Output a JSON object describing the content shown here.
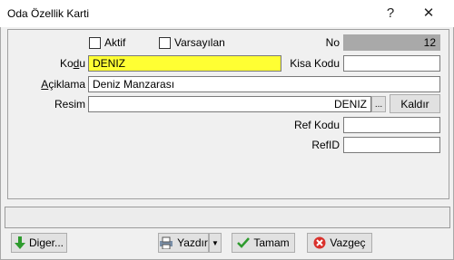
{
  "window": {
    "title": "Oda Özellik Karti",
    "help_glyph": "?",
    "close_glyph": "✕"
  },
  "form": {
    "aktif_label": "Aktif",
    "varsayilan_label": "Varsayılan",
    "no_label": "No",
    "no_value": "12",
    "kodu_label": "Kodu",
    "kodu_value": "DENIZ",
    "kisa_kodu_label": "Kisa Kodu",
    "kisa_kodu_value": "",
    "aciklama_label": "Açiklama",
    "aciklama_value": "Deniz Manzarası",
    "resim_label": "Resim",
    "resim_value": "DENIZ",
    "browse_label": "...",
    "kaldir_label": "Kaldır",
    "ref_kodu_label": "Ref Kodu",
    "ref_kodu_value": "",
    "refid_label": "RefID",
    "refid_value": ""
  },
  "buttons": {
    "diger": "Diger...",
    "yazdir": "Yazdır",
    "tamam": "Tamam",
    "vazgec": "Vazgeç"
  },
  "colors": {
    "kodu_bg": "#ffff33",
    "no_bg": "#a9a9a9"
  }
}
